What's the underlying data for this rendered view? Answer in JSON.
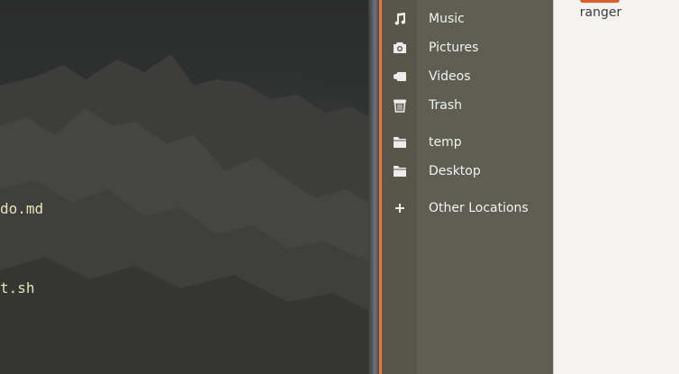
{
  "terminal": {
    "lines": [
      "do.md",
      "t.sh"
    ],
    "text_color": "#e8e2b8"
  },
  "sidebar": {
    "items": [
      {
        "label": "Music",
        "icon": "music-note-icon"
      },
      {
        "label": "Pictures",
        "icon": "camera-icon"
      },
      {
        "label": "Videos",
        "icon": "video-camera-icon"
      },
      {
        "label": "Trash",
        "icon": "trash-icon"
      },
      {
        "label": "temp",
        "icon": "folder-icon"
      },
      {
        "label": "Desktop",
        "icon": "folder-icon"
      },
      {
        "label": "Other Locations",
        "icon": "plus-icon"
      }
    ],
    "background": "#5f5e53",
    "accent": "#e8743b"
  },
  "main": {
    "items": [
      {
        "label": "ranger",
        "icon": "folder-icon"
      }
    ],
    "background": "#f4f3f2"
  }
}
